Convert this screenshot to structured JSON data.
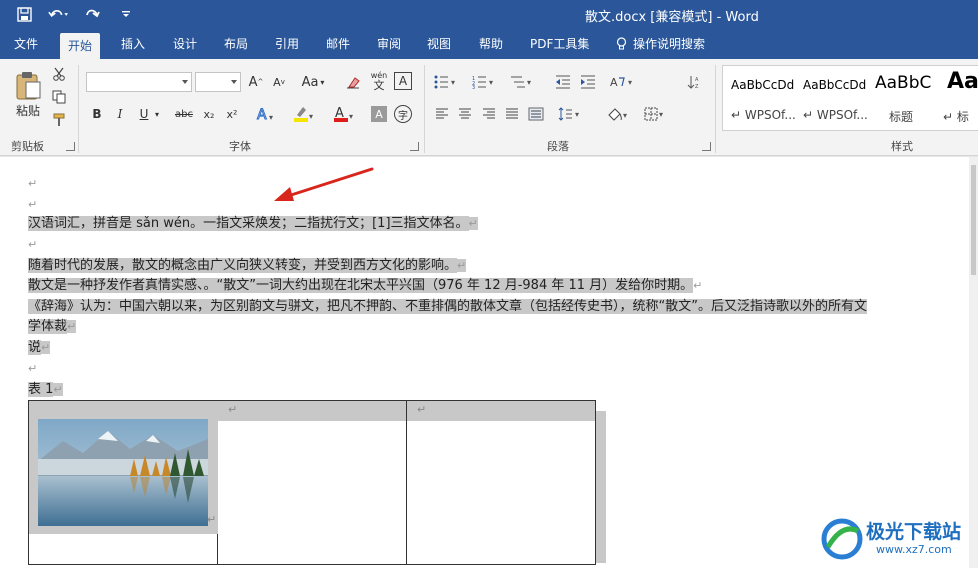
{
  "window": {
    "title": "散文.docx [兼容模式]  -  Word"
  },
  "qat": [
    {
      "name": "save-icon"
    },
    {
      "name": "undo-icon"
    },
    {
      "name": "redo-icon"
    },
    {
      "name": "customize-qat-icon"
    }
  ],
  "tabs": [
    "文件",
    "开始",
    "插入",
    "设计",
    "布局",
    "引用",
    "邮件",
    "审阅",
    "视图",
    "帮助",
    "PDF工具集",
    "操作说明搜索"
  ],
  "active_tab": "开始",
  "ribbon": {
    "clipboard": {
      "paste_label": "粘贴",
      "group_label": "剪贴板"
    },
    "font": {
      "group_label": "字体",
      "font_name": "",
      "font_size": "",
      "bold": "B",
      "italic": "I",
      "underline": "U",
      "strike": "abc",
      "subscript": "x₂",
      "superscript": "x²",
      "grow": "A",
      "shrink": "A",
      "case": "Aa",
      "phonetic_top": "wén",
      "phonetic_bottom": "文"
    },
    "paragraph": {
      "group_label": "段落"
    },
    "styles": {
      "group_label": "样式",
      "items": [
        {
          "sample": "AaBbCcDd",
          "name": "↵ WPSOf..."
        },
        {
          "sample": "AaBbCcDd",
          "name": "↵ WPSOf..."
        },
        {
          "sample": "AaBbC",
          "name": "标题"
        },
        {
          "sample": "AaB",
          "name": "↵ 标"
        }
      ]
    }
  },
  "document": {
    "paragraph_mark": "↵",
    "lines": [
      "汉语词汇，拼音是 sǎn wén。一指文采焕发；二指扰行文；[1]三指文体名。",
      "随着时代的发展，散文的概念由广义向狭义转变，并受到西方文化的影响。",
      "散文是一种抒发作者真情实感、。“散文”一词大约出现在北宋太平兴国（976 年 12 月-984 年 11 月）发给你时期。",
      "《辞海》认为：中国六朝以来，为区别韵文与骈文，把凡不押韵、不重排偶的散体文章（包括经传史书），统称“散文”。后又泛指诗歌以外的所有文",
      "学体裁",
      "说"
    ],
    "table_caption": "表  1"
  },
  "watermark": {
    "cn": "极光下载站",
    "url": "www.xz7.com"
  },
  "colors": {
    "accent": "#2b579a",
    "selection": "#c8c8c8",
    "arrow": "#d9261c"
  }
}
